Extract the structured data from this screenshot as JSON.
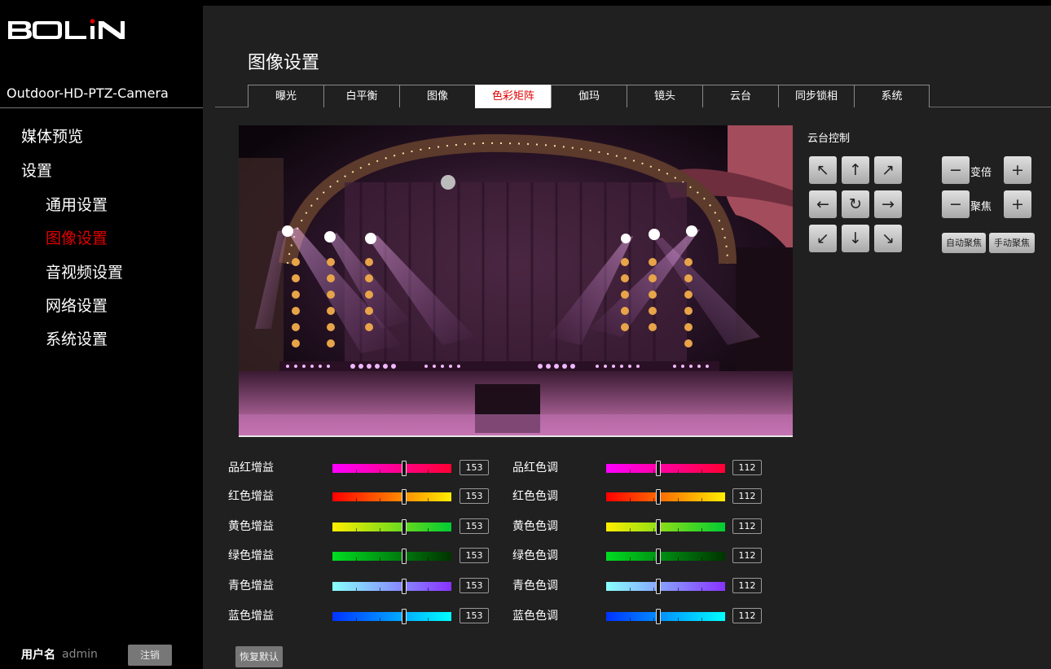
{
  "brand": {
    "logo": "BOLIN"
  },
  "device": {
    "model": "Outdoor-HD-PTZ-Camera"
  },
  "nav": {
    "media_preview": "媒体预览",
    "settings": "设置",
    "general": "通用设置",
    "image": "图像设置",
    "av": "音视频设置",
    "network": "网络设置",
    "system": "系统设置"
  },
  "user": {
    "label": "用户名",
    "name": "admin",
    "logout": "注销"
  },
  "page": {
    "title": "图像设置"
  },
  "tabs": [
    "曝光",
    "白平衡",
    "图像",
    "色彩矩阵",
    "伽玛",
    "镜头",
    "云台",
    "同步锁相",
    "系统"
  ],
  "active_tab": "色彩矩阵",
  "ptz": {
    "title": "云台控制",
    "zoom_label": "变倍",
    "focus_label": "聚焦",
    "auto_focus": "自动聚焦",
    "manual_focus": "手动聚焦",
    "icons": {
      "up_left": "↖",
      "up": "↑",
      "up_right": "↗",
      "left": "←",
      "home": "↻",
      "right": "→",
      "down_left": "↙",
      "down": "↓",
      "down_right": "↘",
      "minus": "−",
      "plus": "+"
    }
  },
  "color_matrix": {
    "gain": [
      {
        "label": "品红增益",
        "value": "153"
      },
      {
        "label": "红色增益",
        "value": "153"
      },
      {
        "label": "黄色增益",
        "value": "153"
      },
      {
        "label": "绿色增益",
        "value": "153"
      },
      {
        "label": "青色增益",
        "value": "153"
      },
      {
        "label": "蓝色增益",
        "value": "153"
      }
    ],
    "hue": [
      {
        "label": "品红色调",
        "value": "112"
      },
      {
        "label": "红色色调",
        "value": "112"
      },
      {
        "label": "黄色色调",
        "value": "112"
      },
      {
        "label": "绿色色调",
        "value": "112"
      },
      {
        "label": "青色色调",
        "value": "112"
      },
      {
        "label": "蓝色色调",
        "value": "112"
      }
    ]
  },
  "colors": {
    "accent_red": "#e00000",
    "magenta_gradient": [
      "#ff00ff",
      "#ff0033"
    ],
    "red_gradient": [
      "#ff0000",
      "#ffee00"
    ],
    "yellow_gradient": [
      "#ffee00",
      "#00cc33"
    ],
    "green_gradient": [
      "#00dd22",
      "#003300"
    ],
    "cyan_gradient": [
      "#88ffff",
      "#8833ff"
    ],
    "blue_gradient": [
      "#0033ff",
      "#00ffff"
    ]
  },
  "restore": {
    "label": "恢复默认"
  }
}
